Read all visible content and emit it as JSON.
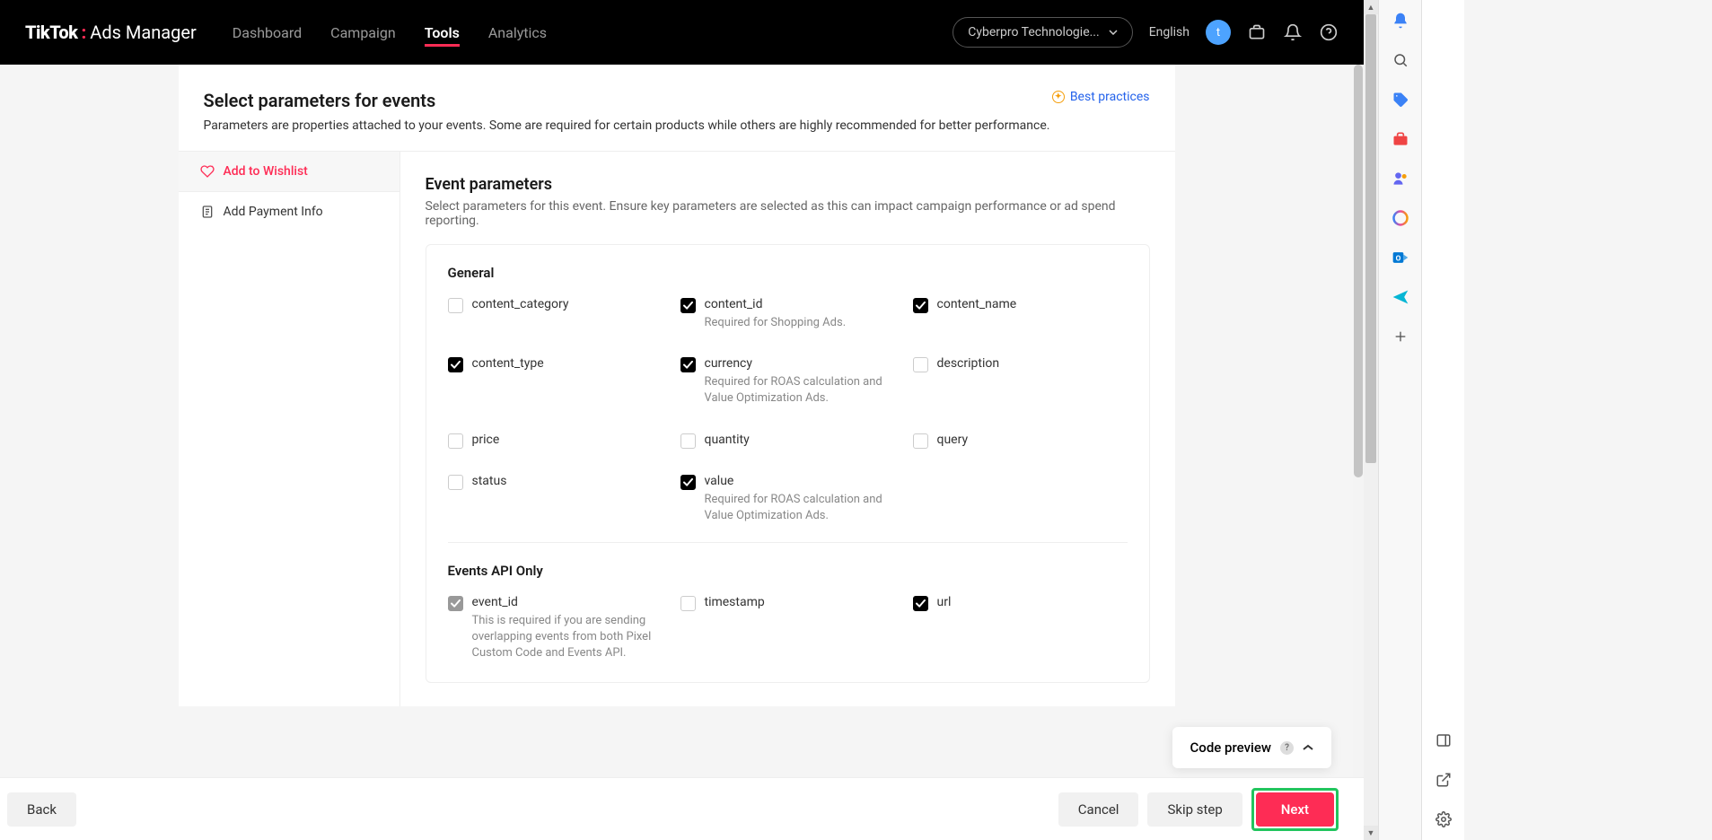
{
  "header": {
    "logo_brand": "TikTok",
    "logo_suffix": "Ads Manager",
    "nav": [
      "Dashboard",
      "Campaign",
      "Tools",
      "Analytics"
    ],
    "active_nav": "Tools",
    "org_name": "Cyberpro Technologie...",
    "language": "English",
    "avatar_initial": "t"
  },
  "page": {
    "title": "Select parameters for events",
    "subtitle": "Parameters are properties attached to your events. Some are required for certain products while others are highly recommended for better performance.",
    "best_practices": "Best practices"
  },
  "events": [
    {
      "label": "Add to Wishlist",
      "icon": "heart",
      "active": true
    },
    {
      "label": "Add Payment Info",
      "icon": "clipboard",
      "active": false
    }
  ],
  "params": {
    "title": "Event parameters",
    "subtitle": "Select parameters for this event. Ensure key parameters are selected as this can impact campaign performance or ad spend reporting.",
    "groups": [
      {
        "name": "General",
        "items": [
          {
            "name": "content_category",
            "checked": false
          },
          {
            "name": "content_id",
            "checked": true,
            "hint": "Required for Shopping Ads."
          },
          {
            "name": "content_name",
            "checked": true
          },
          {
            "name": "content_type",
            "checked": true
          },
          {
            "name": "currency",
            "checked": true,
            "hint": "Required for ROAS calculation and Value Optimization Ads."
          },
          {
            "name": "description",
            "checked": false
          },
          {
            "name": "price",
            "checked": false
          },
          {
            "name": "quantity",
            "checked": false
          },
          {
            "name": "query",
            "checked": false
          },
          {
            "name": "status",
            "checked": false
          },
          {
            "name": "value",
            "checked": true,
            "hint": "Required for ROAS calculation and Value Optimization Ads."
          }
        ]
      },
      {
        "name": "Events API Only",
        "items": [
          {
            "name": "event_id",
            "checked": true,
            "disabled": true,
            "hint": "This is required if you are sending overlapping events from both Pixel Custom Code and Events API."
          },
          {
            "name": "timestamp",
            "checked": false
          },
          {
            "name": "url",
            "checked": true
          }
        ]
      }
    ]
  },
  "code_preview": {
    "label": "Code preview"
  },
  "footer": {
    "back": "Back",
    "cancel": "Cancel",
    "skip": "Skip step",
    "next": "Next"
  }
}
